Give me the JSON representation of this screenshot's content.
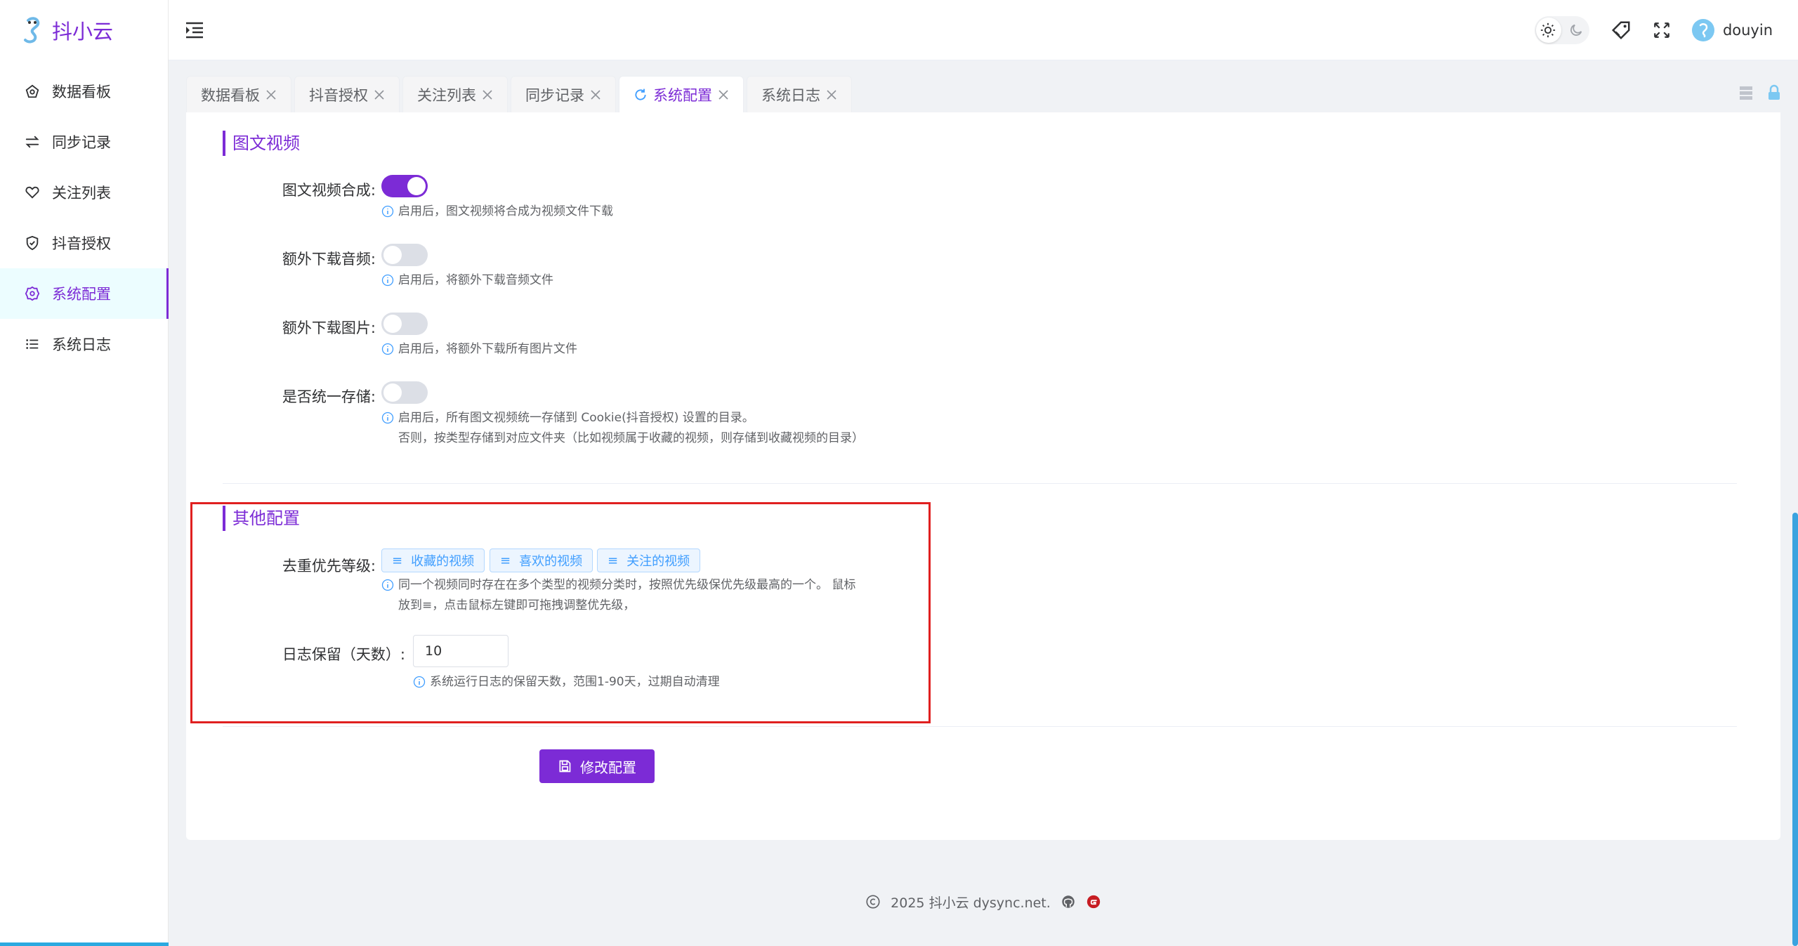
{
  "app": {
    "name": "抖小云"
  },
  "colors": {
    "accent": "#7c2bd6",
    "tag_blue": "#409eff",
    "highlight": "#e02020"
  },
  "sidebar": {
    "items": [
      {
        "label": "数据看板",
        "icon": "dashboard-icon"
      },
      {
        "label": "同步记录",
        "icon": "sync-icon"
      },
      {
        "label": "关注列表",
        "icon": "heart-icon"
      },
      {
        "label": "抖音授权",
        "icon": "shield-icon"
      },
      {
        "label": "系统配置",
        "icon": "gear-icon",
        "active": true
      },
      {
        "label": "系统日志",
        "icon": "list-icon"
      }
    ]
  },
  "header": {
    "username": "douyin"
  },
  "tabs": [
    {
      "label": "数据看板"
    },
    {
      "label": "抖音授权"
    },
    {
      "label": "关注列表"
    },
    {
      "label": "同步记录"
    },
    {
      "label": "系统配置",
      "active": true
    },
    {
      "label": "系统日志"
    }
  ],
  "section_media": {
    "title": "图文视频",
    "fields": [
      {
        "label": "图文视频合成:",
        "on": true,
        "hint": "启用后，图文视频将合成为视频文件下载"
      },
      {
        "label": "额外下载音频:",
        "on": false,
        "hint": "启用后，将额外下载音频文件"
      },
      {
        "label": "额外下载图片:",
        "on": false,
        "hint": "启用后，将额外下载所有图片文件"
      },
      {
        "label": "是否统一存储:",
        "on": false,
        "hint": "启用后，所有图文视频统一存储到 Cookie(抖音授权) 设置的目录。",
        "hint2": "否则，按类型存储到对应文件夹（比如视频属于收藏的视频，则存储到收藏视频的目录）"
      }
    ]
  },
  "section_other": {
    "title": "其他配置",
    "dedupe_label": "去重优先等级:",
    "tags": [
      "收藏的视频",
      "喜欢的视频",
      "关注的视频"
    ],
    "dedupe_hint_1": "同一个视频同时存在在多个类型的视频分类时，按照优先级保优先级最高的一个。 鼠标",
    "dedupe_hint_2": "放到≡，点击鼠标左键即可拖拽调整优先级，",
    "log_label": "日志保留（天数）:",
    "log_value": "10",
    "log_hint": "系统运行日志的保留天数，范围1-90天，过期自动清理"
  },
  "submit_label": "修改配置",
  "footer": {
    "text": "2025 抖小云 dysync.net."
  }
}
